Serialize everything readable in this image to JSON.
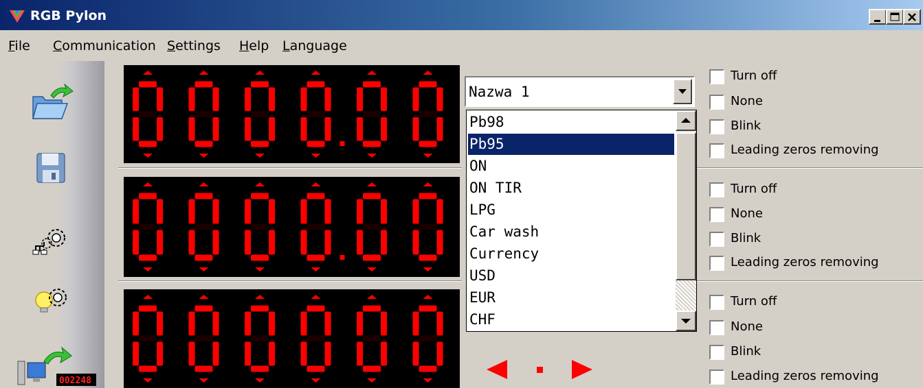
{
  "window": {
    "title": "RGB Pylon"
  },
  "menu": [
    {
      "first": "F",
      "rest": "ile"
    },
    {
      "first": "C",
      "rest": "ommunication"
    },
    {
      "first": "S",
      "rest": "ettings"
    },
    {
      "first": "H",
      "rest": "elp"
    },
    {
      "first": "L",
      "rest": "anguage"
    }
  ],
  "toolbar": {
    "mini_display_text": "002248"
  },
  "displays": [
    {
      "text": "000000",
      "decimal_point": true
    },
    {
      "text": "000000",
      "decimal_point": true
    },
    {
      "text": "000000",
      "decimal_point": false
    }
  ],
  "combo": {
    "value": "Nazwa 1",
    "options": [
      "Pb98",
      "Pb95",
      "ON",
      "ON TIR",
      "LPG",
      "Car wash",
      "Currency",
      "USD",
      "EUR",
      "CHF"
    ],
    "selected_index": 1
  },
  "checkboxes": {
    "turn_off": "Turn off",
    "none": "None",
    "blink": "Blink",
    "leading_zeros": "Leading zeros removing"
  },
  "colors": {
    "segment_on": "#ff0000",
    "segment_off": "#1a0000",
    "selection": "#0a246a",
    "title_start": "#0a246a"
  }
}
